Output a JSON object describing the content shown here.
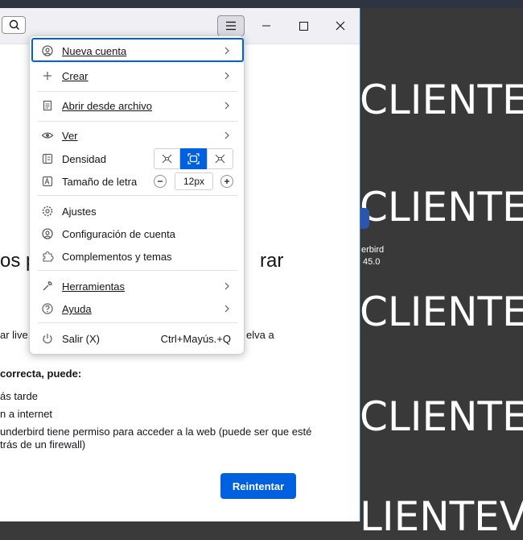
{
  "desktop": {
    "watermark_texts": [
      "CLIENTEV",
      "CLIENTE",
      "CLIENTEV",
      "CLIENTEV",
      "LIENTEV"
    ],
    "icon_label_line1": "erbird",
    "icon_label_line2": "45.0"
  },
  "content": {
    "heading_left": "os p",
    "heading_right": "rar",
    "line1_left": "ar live.",
    "line1_right": "elva a",
    "bold_line": "correcta, puede:",
    "item1": "ás tarde",
    "item2": "n a internet",
    "item3_line1": "underbird tiene permiso para acceder a la web (puede ser que esté",
    "item3_line2": "trás de un firewall)",
    "retry_label": "Reintentar"
  },
  "menu": {
    "new_account": "Nueva cuenta",
    "create": "Crear",
    "open_file": "Abrir desde archivo",
    "view": "Ver",
    "density": "Densidad",
    "font_size": "Tamaño de letra",
    "font_size_value": "12px",
    "settings": "Ajustes",
    "account_settings": "Configuración de cuenta",
    "addons": "Complementos y temas",
    "tools": "Herramientas",
    "help": "Ayuda",
    "exit": "Salir (X)",
    "exit_shortcut": "Ctrl+Mayús.+Q"
  },
  "colors": {
    "accent": "#0061e0",
    "menu_bg": "#ffffff",
    "desktop_bg": "#393939"
  }
}
